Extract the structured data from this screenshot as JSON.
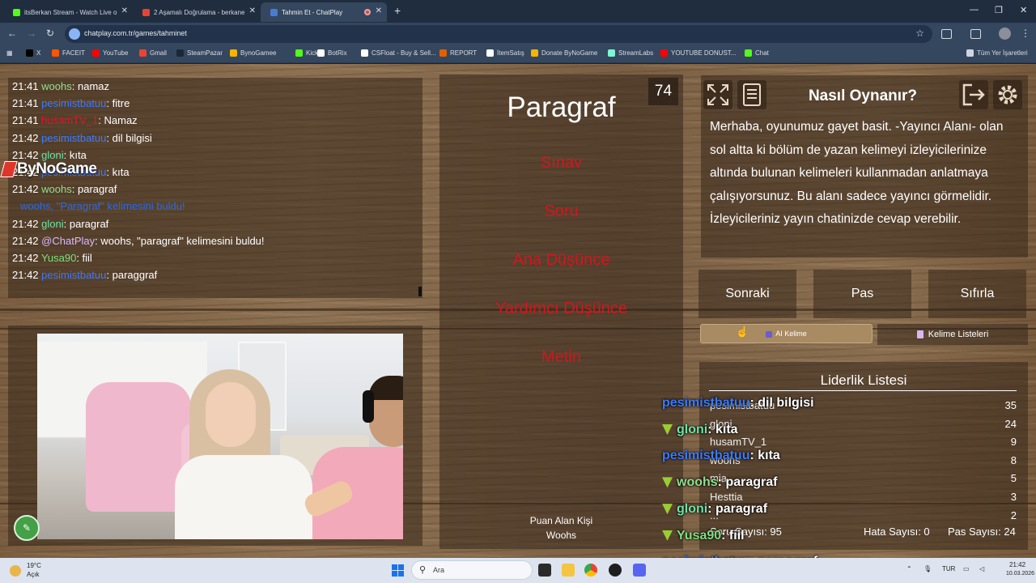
{
  "browser": {
    "tabs": [
      {
        "title": "itsBerkan Stream - Watch Live o",
        "favicon_color": "#53fc18",
        "active": false
      },
      {
        "title": "2 Aşamalı Doğrulama - berkane",
        "favicon_color": "#ea4335",
        "active": false
      },
      {
        "title": "Tahmin Et - ChatPlay",
        "favicon_color": "#4a7bd0",
        "active": true
      }
    ],
    "url": "chatplay.com.tr/games/tahminet",
    "bookmarks": [
      {
        "label": "X",
        "color": "#000000"
      },
      {
        "label": "FACEIT",
        "color": "#ff5500"
      },
      {
        "label": "YouTube",
        "color": "#ff0000"
      },
      {
        "label": "Gmail",
        "color": "#ea4335"
      },
      {
        "label": "SteamPazar",
        "color": "#1b2838"
      },
      {
        "label": "BynoGamee",
        "color": "#f5b400"
      },
      {
        "label": "Kick",
        "color": "#53fc18"
      },
      {
        "label": "BotRix",
        "color": "#ffffff"
      },
      {
        "label": "CSFloat - Buy & Sell...",
        "color": "#ffffff"
      },
      {
        "label": "REPORT",
        "color": "#e06000"
      },
      {
        "label": "İtemSatış",
        "color": "#ffffff"
      },
      {
        "label": "Donate ByNoGame",
        "color": "#f5b400"
      },
      {
        "label": "StreamLabs",
        "color": "#80f5d2"
      },
      {
        "label": "YOUTUBE DONUST...",
        "color": "#ff0000"
      },
      {
        "label": "Chat",
        "color": "#53fc18"
      }
    ],
    "all_bookmarks": "Tüm Yer İşaretleri"
  },
  "chat": {
    "lines": [
      {
        "time": "21:41",
        "user": "woohs",
        "color": "#8fe08f",
        "sep": ": ",
        "msg": "namaz"
      },
      {
        "time": "21:41",
        "user": "pesimistbatuu",
        "color": "#3b7bff",
        "sep": ": ",
        "msg": "fitre"
      },
      {
        "time": "21:41",
        "user": "husamTV_1",
        "color": "#e0162b",
        "sep": ": ",
        "msg": "Namaz"
      },
      {
        "time": "21:42",
        "user": "pesimistbatuu",
        "color": "#3b7bff",
        "sep": ": ",
        "msg": "dil bilgisi"
      },
      {
        "time": "21:42",
        "user": "gloni",
        "color": "#6fe2a5",
        "sep": ": ",
        "msg": "kıta"
      },
      {
        "time": "21:42",
        "user": "pesimistbatuu",
        "color": "#3b7bff",
        "sep": ": ",
        "msg": "kıta"
      },
      {
        "time": "21:42",
        "user": "woohs",
        "color": "#8fe08f",
        "sep": ": ",
        "msg": "paragraf"
      },
      {
        "time": "",
        "user": "woohs, \"Paragraf\" kelimesini buldu!",
        "color": "#2d6ae0",
        "sep": "",
        "msg": ""
      },
      {
        "time": "21:42",
        "user": "gloni",
        "color": "#6fe2a5",
        "sep": ": ",
        "msg": "paragraf"
      },
      {
        "time": "21:42",
        "user": "@ChatPlay",
        "color": "#d9b8ff",
        "sep": ": ",
        "msg": "woohs, \"paragraf\" kelimesini buldu!"
      },
      {
        "time": "21:42",
        "user": "Yusa90",
        "color": "#7ee07e",
        "sep": ": ",
        "msg": "fiil"
      },
      {
        "time": "21:42",
        "user": "pesimistbatuu",
        "color": "#3b7bff",
        "sep": ": ",
        "msg": "paraggraf"
      }
    ]
  },
  "overlay_logo": "ByNoGame",
  "game": {
    "count": "74",
    "word": "Paragraf",
    "forbidden": [
      "Sınav",
      "Soru",
      "Ana Düşünce",
      "Yardımcı Düşünce",
      "Metin"
    ],
    "scorer_label": "Puan Alan Kişi",
    "scorer_name": "Woohs"
  },
  "help": {
    "title": "Nasıl Oynanır?",
    "text": "Merhaba, oyunumuz gayet basit. -Yayıncı Alanı- olan sol altta ki bölüm de yazan kelimeyi izleyicilerinize altında bulunan kelimeleri kullanmadan anlatmaya çalışıyorsunuz. Bu alanı sadece yayıncı görmelidir. İzleyicileriniz yayın chatinizde cevap verebilir."
  },
  "actions": {
    "next": "Sonraki",
    "pass": "Pas",
    "reset": "Sıfırla",
    "ai_word": "AI Kelime",
    "word_lists": "Kelime Listeleri"
  },
  "leaderboard": {
    "title": "Liderlik Listesi",
    "rows": [
      {
        "name": "pesimistbatuu",
        "score": "35"
      },
      {
        "name": "gloni",
        "score": "24"
      },
      {
        "name": "husamTV_1",
        "score": "9"
      },
      {
        "name": "woohs",
        "score": "8"
      },
      {
        "name": "mia_...",
        "score": "5"
      },
      {
        "name": "Hesttia",
        "score": "3"
      },
      {
        "name": "...",
        "score": "2"
      }
    ],
    "question_count": "Soru Sayısı: 95",
    "error_count": "Hata Sayısı: 0",
    "pass_count": "Pas Sayısı: 24"
  },
  "overlay_chat": [
    {
      "user": "pesimistbatuu",
      "color": "#3b7bff",
      "badge": false,
      "msg": ": dil bilgisi"
    },
    {
      "user": "gloni",
      "color": "#6fe2a5",
      "badge": true,
      "msg": ": kıta"
    },
    {
      "user": "pesimistbatuu",
      "color": "#3b7bff",
      "badge": false,
      "msg": ": kıta"
    },
    {
      "user": "woohs",
      "color": "#8fe08f",
      "badge": true,
      "msg": ": paragraf"
    },
    {
      "user": "gloni",
      "color": "#6fe2a5",
      "badge": true,
      "msg": ": paragraf"
    },
    {
      "user": "Yusa90",
      "color": "#7ee07e",
      "badge": true,
      "msg": ": fiil"
    },
    {
      "user": "pesimistbatuu",
      "color": "#3b7bff",
      "badge": false,
      "msg": ": paraggraf"
    }
  ],
  "taskbar": {
    "weather_temp": "19°C",
    "weather_desc": "Açık",
    "search_placeholder": "Ara",
    "lang": "TUR",
    "time": "21:42",
    "date": "10.03.2026"
  }
}
